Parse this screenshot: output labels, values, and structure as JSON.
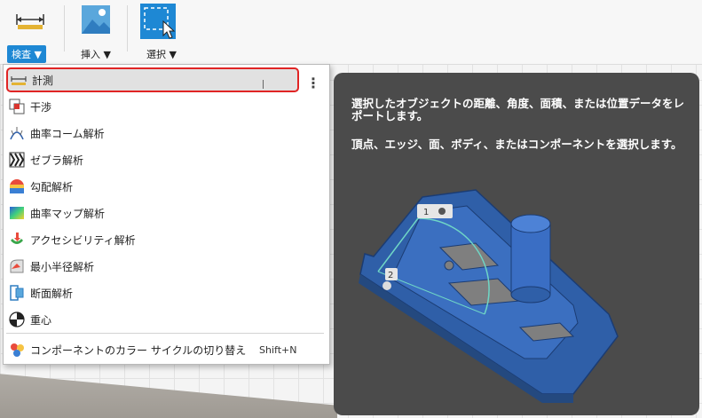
{
  "toolbar": {
    "groups": [
      {
        "label": "検査 ▼",
        "icon": "ruler-icon",
        "active": true
      },
      {
        "label": "挿入 ▼",
        "icon": "image-insert-icon",
        "active": false
      },
      {
        "label": "選択 ▼",
        "icon": "select-cursor-icon",
        "active": false
      }
    ]
  },
  "menu": {
    "items": [
      {
        "label": "計測",
        "icon": "measure-icon"
      },
      {
        "label": "干渉",
        "icon": "interference-icon"
      },
      {
        "label": "曲率コーム解析",
        "icon": "curvature-comb-icon"
      },
      {
        "label": "ゼブラ解析",
        "icon": "zebra-icon"
      },
      {
        "label": "勾配解析",
        "icon": "draft-analysis-icon"
      },
      {
        "label": "曲率マップ解析",
        "icon": "curvature-map-icon"
      },
      {
        "label": "アクセシビリティ解析",
        "icon": "accessibility-icon"
      },
      {
        "label": "最小半径解析",
        "icon": "minimum-radius-icon"
      },
      {
        "label": "断面解析",
        "icon": "section-icon"
      },
      {
        "label": "重心",
        "icon": "center-of-mass-icon"
      },
      {
        "label": "コンポーネントのカラー サイクルの切り替え",
        "icon": "color-cycle-icon",
        "shortcut": "Shift+N"
      }
    ],
    "more_label": "⋮"
  },
  "tooltip": {
    "line1": "選択したオブジェクトの距離、角度、面積、または位置データをレポートします。",
    "line2": "頂点、エッジ、面、ボディ、またはコンポーネントを選択します。",
    "marker1": "1",
    "marker2": "2"
  },
  "colors": {
    "accent": "#1e88d4",
    "highlight_border": "#e02424",
    "tooltip_bg": "#4b4b4b",
    "part_blue": "#2f5fa8"
  }
}
